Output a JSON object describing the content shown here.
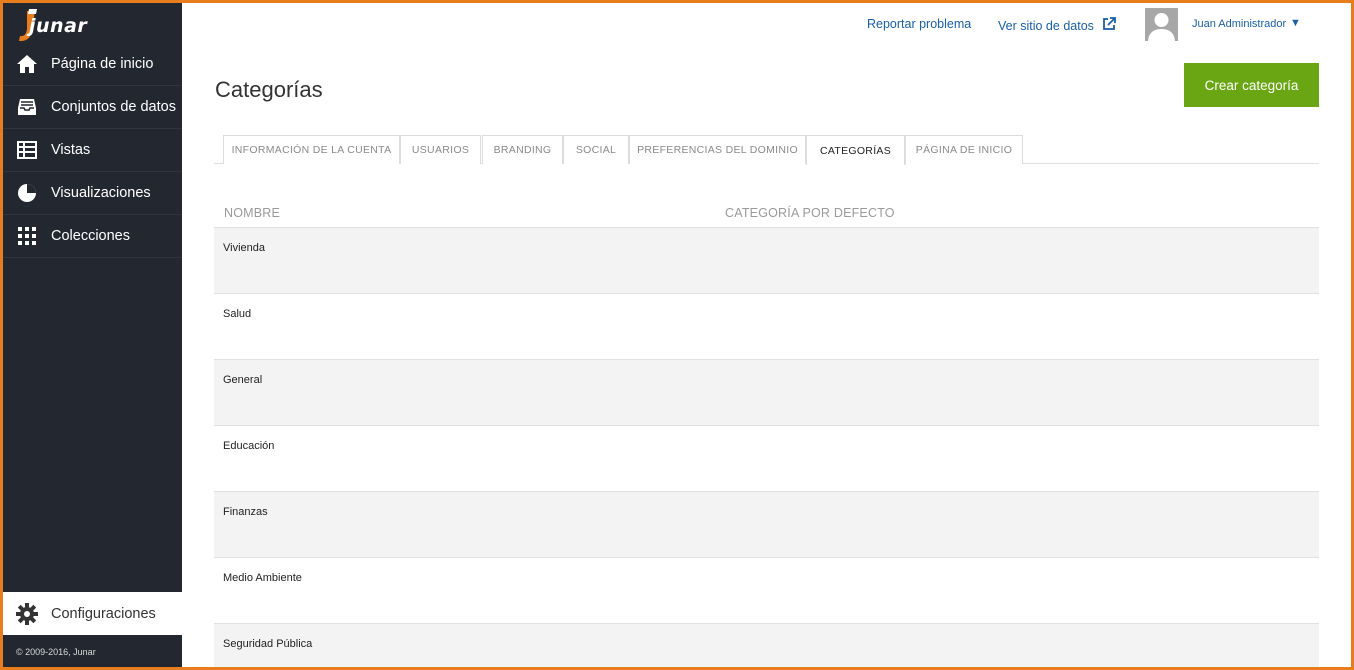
{
  "brand": {
    "logo_text": "junar",
    "accent_color": "#e87d1e"
  },
  "sidebar": {
    "items": [
      {
        "label": "Página de inicio",
        "icon": "home-icon"
      },
      {
        "label": "Conjuntos de datos",
        "icon": "inbox-icon"
      },
      {
        "label": "Vistas",
        "icon": "table-icon"
      },
      {
        "label": "Visualizaciones",
        "icon": "pie-chart-icon"
      },
      {
        "label": "Colecciones",
        "icon": "grid-icon"
      }
    ],
    "config_label": "Configuraciones",
    "copyright": "© 2009-2016, Junar"
  },
  "topbar": {
    "report_label": "Reportar problema",
    "view_site_label": "Ver sitio de datos",
    "user_name": "Juan Administrador"
  },
  "page": {
    "title": "Categorías",
    "create_button": "Crear categoría"
  },
  "tabs": [
    {
      "label": "INFORMACIÓN DE LA CUENTA",
      "active": false
    },
    {
      "label": "USUARIOS",
      "active": false
    },
    {
      "label": "BRANDING",
      "active": false
    },
    {
      "label": "SOCIAL",
      "active": false
    },
    {
      "label": "PREFERENCIAS DEL DOMINIO",
      "active": false
    },
    {
      "label": "CATEGORÍAS",
      "active": true
    },
    {
      "label": "PÁGINA DE INICIO",
      "active": false
    }
  ],
  "table": {
    "headers": [
      "NOMBRE",
      "CATEGORÍA POR DEFECTO"
    ],
    "rows": [
      {
        "name": "Vivienda"
      },
      {
        "name": "Salud"
      },
      {
        "name": "General"
      },
      {
        "name": "Educación"
      },
      {
        "name": "Finanzas"
      },
      {
        "name": "Medio Ambiente"
      },
      {
        "name": "Seguridad Pública"
      }
    ]
  }
}
